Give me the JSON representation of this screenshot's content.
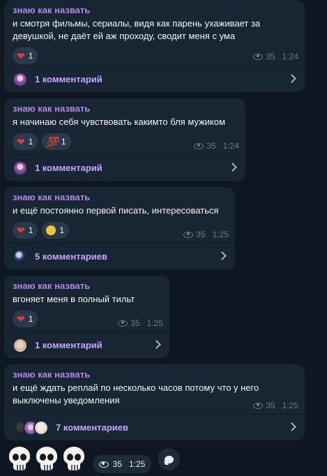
{
  "messages": [
    {
      "author": "знаю как назвать",
      "text": "и смотря фильмы, сериалы, видя как парень ухаживает за девушкой, не даёт ей аж проходу, сводит меня с ума",
      "reactions": [
        {
          "emoji": "heart",
          "count": "1"
        }
      ],
      "views": "35",
      "time": "1:24",
      "comments": "1 комментарий"
    },
    {
      "author": "знаю как назвать",
      "text": "я начинаю себя чувствовать какимто бля мужиком",
      "reactions": [
        {
          "emoji": "heart",
          "count": "1"
        },
        {
          "emoji": "hundred",
          "count": "1"
        }
      ],
      "views": "35",
      "time": "1:24",
      "comments": "1 комментарий"
    },
    {
      "author": "знаю как назвать",
      "text": "и ещё постоянно первой писать, интересоваться",
      "reactions": [
        {
          "emoji": "heart",
          "count": "1"
        },
        {
          "emoji": "sad",
          "count": "1"
        }
      ],
      "views": "35",
      "time": "1:25",
      "comments": "5 комментариев"
    },
    {
      "author": "знаю как назвать",
      "text": "вгоняет меня в полный тильт",
      "reactions": [
        {
          "emoji": "heart",
          "count": "1"
        }
      ],
      "views": "35",
      "time": "1:25",
      "comments": "1 комментарий"
    },
    {
      "author": "знаю как назвать",
      "text": "и ещё ждать реплай по несколько часов потому что у него выключены уведомления",
      "reactions": [],
      "views": "35",
      "time": "1:25",
      "comments": "7 комментариев"
    }
  ],
  "last": {
    "sticker": "skull",
    "views": "35",
    "time": "1:25"
  },
  "icons": {
    "heart": "❤",
    "hundred": "💯",
    "views": "eye-icon",
    "chevron": "chevron-right-icon",
    "reply": "comment-icon"
  },
  "colors": {
    "background": "#0e1621",
    "bubble": "#182533",
    "author": "#b286e8",
    "comments_link": "#c6a6ff",
    "meta": "#6c7883"
  }
}
